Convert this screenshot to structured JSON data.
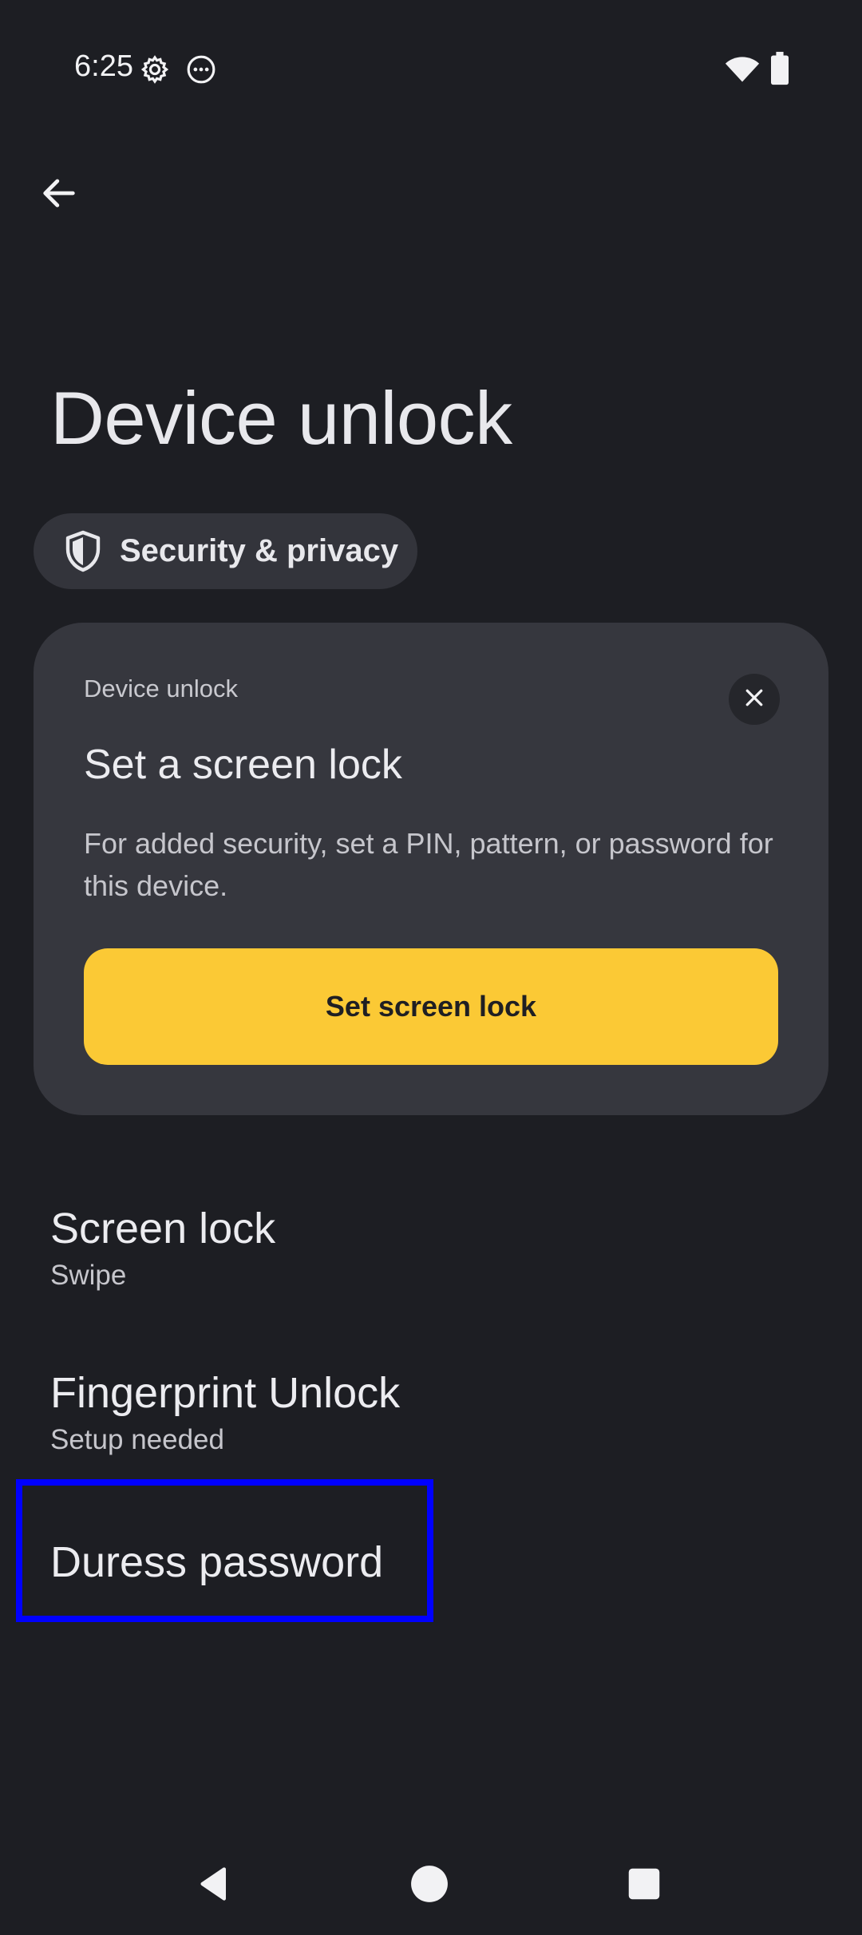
{
  "status_bar": {
    "time": "6:25",
    "icons": [
      "settings-gear-icon",
      "more-dots-icon",
      "wifi-icon",
      "battery-icon"
    ]
  },
  "header": {
    "back_icon": "arrow-back-icon",
    "title": "Device unlock"
  },
  "breadcrumb": {
    "icon": "shield-icon",
    "label": "Security & privacy"
  },
  "card": {
    "eyebrow": "Device unlock",
    "title": "Set a screen lock",
    "body": "For added security, set a PIN, pattern, or password for this device.",
    "cta_label": "Set screen lock",
    "close_icon": "close-icon",
    "accent_color": "#fbc935"
  },
  "settings": [
    {
      "title": "Screen lock",
      "subtitle": "Swipe"
    },
    {
      "title": "Fingerprint Unlock",
      "subtitle": "Setup needed"
    },
    {
      "title": "Duress password",
      "subtitle": ""
    }
  ],
  "highlight_color": "#0000ff",
  "nav_bar": {
    "icons": [
      "nav-back-icon",
      "nav-home-icon",
      "nav-recents-icon"
    ]
  }
}
